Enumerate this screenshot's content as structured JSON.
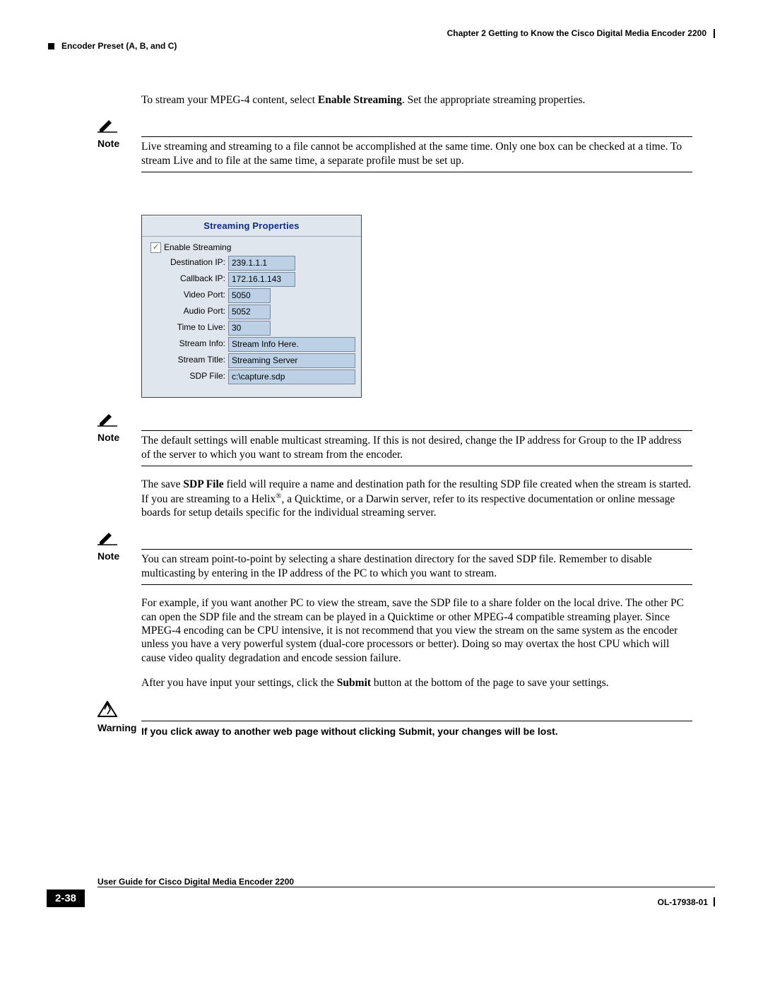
{
  "header": {
    "chapter": "Chapter 2      Getting to Know the Cisco Digital Media Encoder 2200",
    "section": "Encoder Preset (A, B, and C)"
  },
  "p1_a": "To stream your MPEG-4 content, select ",
  "p1_b": "Enable Streaming",
  "p1_c": ". Set the appropriate streaming properties.",
  "note1_label": "Note",
  "note1_body": "Live streaming and streaming to a file cannot be accomplished at the same time. Only one box can be checked at a time. To stream Live and to file at the same time, a separate profile must be set up.",
  "fig": {
    "title": "Streaming Properties",
    "enable_label": "Enable Streaming",
    "rows": [
      {
        "label": "Destination IP:",
        "value": "239.1.1.1",
        "cls": "short"
      },
      {
        "label": "Callback IP:",
        "value": "172.16.1.143",
        "cls": "short"
      },
      {
        "label": "Video Port:",
        "value": "5050",
        "cls": "short2"
      },
      {
        "label": "Audio Port:",
        "value": "5052",
        "cls": "short2"
      },
      {
        "label": "Time to Live:",
        "value": "30",
        "cls": "short2"
      },
      {
        "label": "Stream Info:",
        "value": "Stream Info Here.",
        "cls": "long"
      },
      {
        "label": "Stream Title:",
        "value": "Streaming Server",
        "cls": "long"
      },
      {
        "label": "SDP File:",
        "value": "c:\\capture.sdp",
        "cls": "long"
      }
    ]
  },
  "note2_label": "Note",
  "note2_body": "The default settings will enable multicast streaming. If this is not desired, change the IP address for Group to the IP address of the server to which you want to stream from the encoder.",
  "p2_a": "The save ",
  "p2_b": "SDP File",
  "p2_c": " field will require a name and destination path for the resulting SDP file created when the stream is started. If you are streaming to a Helix",
  "p2_d": ", a Quicktime, or a Darwin server, refer to its respective documentation or online message boards for setup details specific for the individual streaming server.",
  "note3_label": "Note",
  "note3_body": "You can stream point-to-point by selecting a share destination directory for the saved SDP file. Remember to disable multicasting by entering in the IP address of the PC to which you want to stream.",
  "p3": "For example, if you want another PC to view the stream, save the SDP file to a share folder on the local drive. The other PC can open the SDP file and the stream can be played in a Quicktime or other MPEG-4 compatible streaming player. Since MPEG-4 encoding can be CPU intensive, it is not recommend that you view the stream on the same system as the encoder unless you have a very powerful system (dual-core processors or better). Doing so may overtax the host CPU which will cause video quality degradation and encode session failure.",
  "p4_a": "After you have input your settings, click the ",
  "p4_b": "Submit",
  "p4_c": " button at the bottom of the page to save your settings.",
  "warn_label": "Warning",
  "warn_body": "If you click away to another web page without clicking Submit, your changes will be lost.",
  "footer": {
    "title": "User Guide for Cisco Digital Media Encoder 2200",
    "page": "2-38",
    "doc_id": "OL-17938-01"
  }
}
